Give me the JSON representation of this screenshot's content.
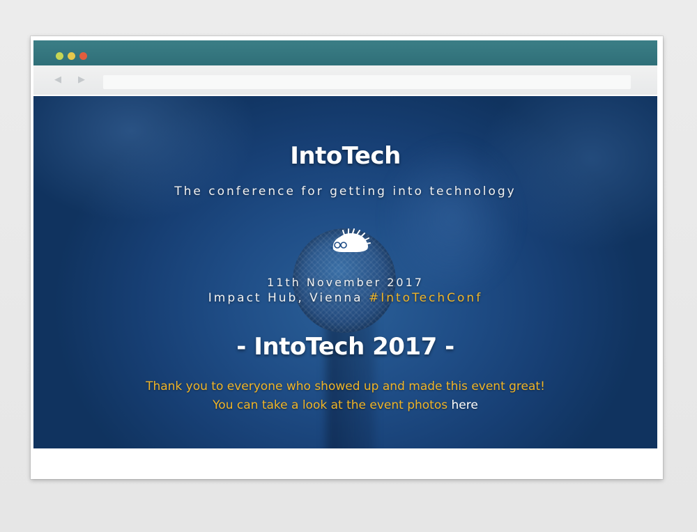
{
  "browser": {
    "traffic_lights": [
      "#c6d655",
      "#e6c84c",
      "#e15d3d"
    ],
    "nav_back_icon": "chevron-left-icon",
    "nav_forward_icon": "chevron-right-icon",
    "address": ""
  },
  "site": {
    "title": "IntoTech",
    "tagline": "The conference for getting into technology",
    "logo_icon": "hedgehog-icon",
    "date": "11th November 2017",
    "location": "Impact Hub, Vienna",
    "hashtag": "#IntoTechConf",
    "edition_heading": "- IntoTech 2017 -",
    "thanks_line_1": "Thank you to everyone who showed up and made this event great!",
    "thanks_line_2_prefix": "You can take a look at the event photos",
    "photos_link_label": "here"
  },
  "colors": {
    "titlebar": "#2f6f78",
    "hero_bg": "#1f4d86",
    "accent_gold": "#f0b528",
    "text_white": "#ffffff"
  }
}
